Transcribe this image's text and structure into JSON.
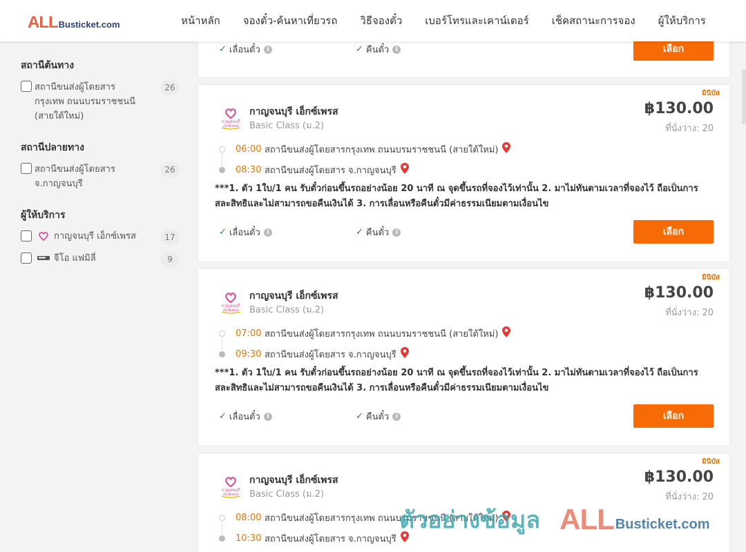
{
  "header": {
    "logo_all": "ALL",
    "logo_rest": "Busticket.com",
    "nav": [
      "หน้าหลัก",
      "จองตั๋ว-ค้นหาเที่ยวรถ",
      "วิธีจองตั๋ว",
      "เบอร์โทรและเคาน์เตอร์",
      "เช็คสถานะการจอง",
      "ผู้ให้บริการ"
    ]
  },
  "sidebar": {
    "origin_title": "สถานีต้นทาง",
    "origin_label": "สถานีขนส่งผู้โดยสารกรุงเทพ ถนนบรมราชชนนี (สายใต้ใหม่)",
    "origin_count": "26",
    "dest_title": "สถานีปลายทาง",
    "dest_label": "สถานีขนส่งผู้โดยสาร จ.กาญจนบุรี",
    "dest_count": "26",
    "operator_title": "ผู้ให้บริการ",
    "op1_label": "กาญจนบุรี เอ็กซ์เพรส",
    "op1_count": "17",
    "op2_label": "จีโอ แฟมิลี่",
    "op2_count": "9"
  },
  "top_partial": {
    "seat_change": "เลื่อนตั๋ว",
    "refund": "คืนตั๋ว",
    "select": "เลือก"
  },
  "trips": [
    {
      "badge": "มินิบัส",
      "operator": "กาญจนบุรี เอ็กซ์เพรส",
      "class": "Basic Class (ม.2)",
      "price": "฿130.00",
      "seats": "ที่นั่งว่าง: 20",
      "depart_time": "06:00",
      "depart_station": "สถานีขนส่งผู้โดยสารกรุงเทพ ถนนบรมราชชนนี (สายใต้ใหม่)",
      "arrive_time": "08:30",
      "arrive_station": "สถานีขนส่งผู้โดยสาร จ.กาญจนบุรี",
      "note": "***1. ตัว 1ใบ/1 คน รับตั๋วก่อนขึ้นรถอย่างน้อย 20 นาที ณ จุดขึ้นรถที่จองไว้เท่านั้น 2. มาไม่ทันตามเวลาที่จองไว้ ถือเป็นการสละสิทธิและไม่สามารถขอคืนเงินได้ 3. การเลื่อนหรือคืนตั๋วมีค่าธรรมเนียมตามเงื่อนไข",
      "seat_change": "เลื่อนตั๋ว",
      "refund": "คืนตั๋ว",
      "select": "เลือก"
    },
    {
      "badge": "มินิบัส",
      "operator": "กาญจนบุรี เอ็กซ์เพรส",
      "class": "Basic Class (ม.2)",
      "price": "฿130.00",
      "seats": "ที่นั่งว่าง: 20",
      "depart_time": "07:00",
      "depart_station": "สถานีขนส่งผู้โดยสารกรุงเทพ ถนนบรมราชชนนี (สายใต้ใหม่)",
      "arrive_time": "09:30",
      "arrive_station": "สถานีขนส่งผู้โดยสาร จ.กาญจนบุรี",
      "note": "***1. ตัว 1ใบ/1 คน รับตั๋วก่อนขึ้นรถอย่างน้อย 20 นาที ณ จุดขึ้นรถที่จองไว้เท่านั้น 2. มาไม่ทันตามเวลาที่จองไว้ ถือเป็นการสละสิทธิและไม่สามารถขอคืนเงินได้ 3. การเลื่อนหรือคืนตั๋วมีค่าธรรมเนียมตามเงื่อนไข",
      "seat_change": "เลื่อนตั๋ว",
      "refund": "คืนตั๋ว",
      "select": "เลือก"
    },
    {
      "badge": "มินิบัส",
      "operator": "กาญจนบุรี เอ็กซ์เพรส",
      "class": "Basic Class (ม.2)",
      "price": "฿130.00",
      "seats": "ที่นั่งว่าง: 20",
      "depart_time": "08:00",
      "depart_station": "สถานีขนส่งผู้โดยสารกรุงเทพ ถนนบรมราชชนนี (สายใต้ใหม่)",
      "arrive_time": "10:30",
      "arrive_station": "สถานีขนส่งผู้โดยสาร จ.กาญจนบุรี"
    }
  ],
  "watermark": {
    "thai": "ตัวอย่างข้อมูล",
    "all": "ALL",
    "rest": "Busticket.com"
  },
  "colors": {
    "accent": "#f76b07",
    "time": "#e87400",
    "brand_red": "#e95f40",
    "brand_blue": "#2c3f7a"
  }
}
